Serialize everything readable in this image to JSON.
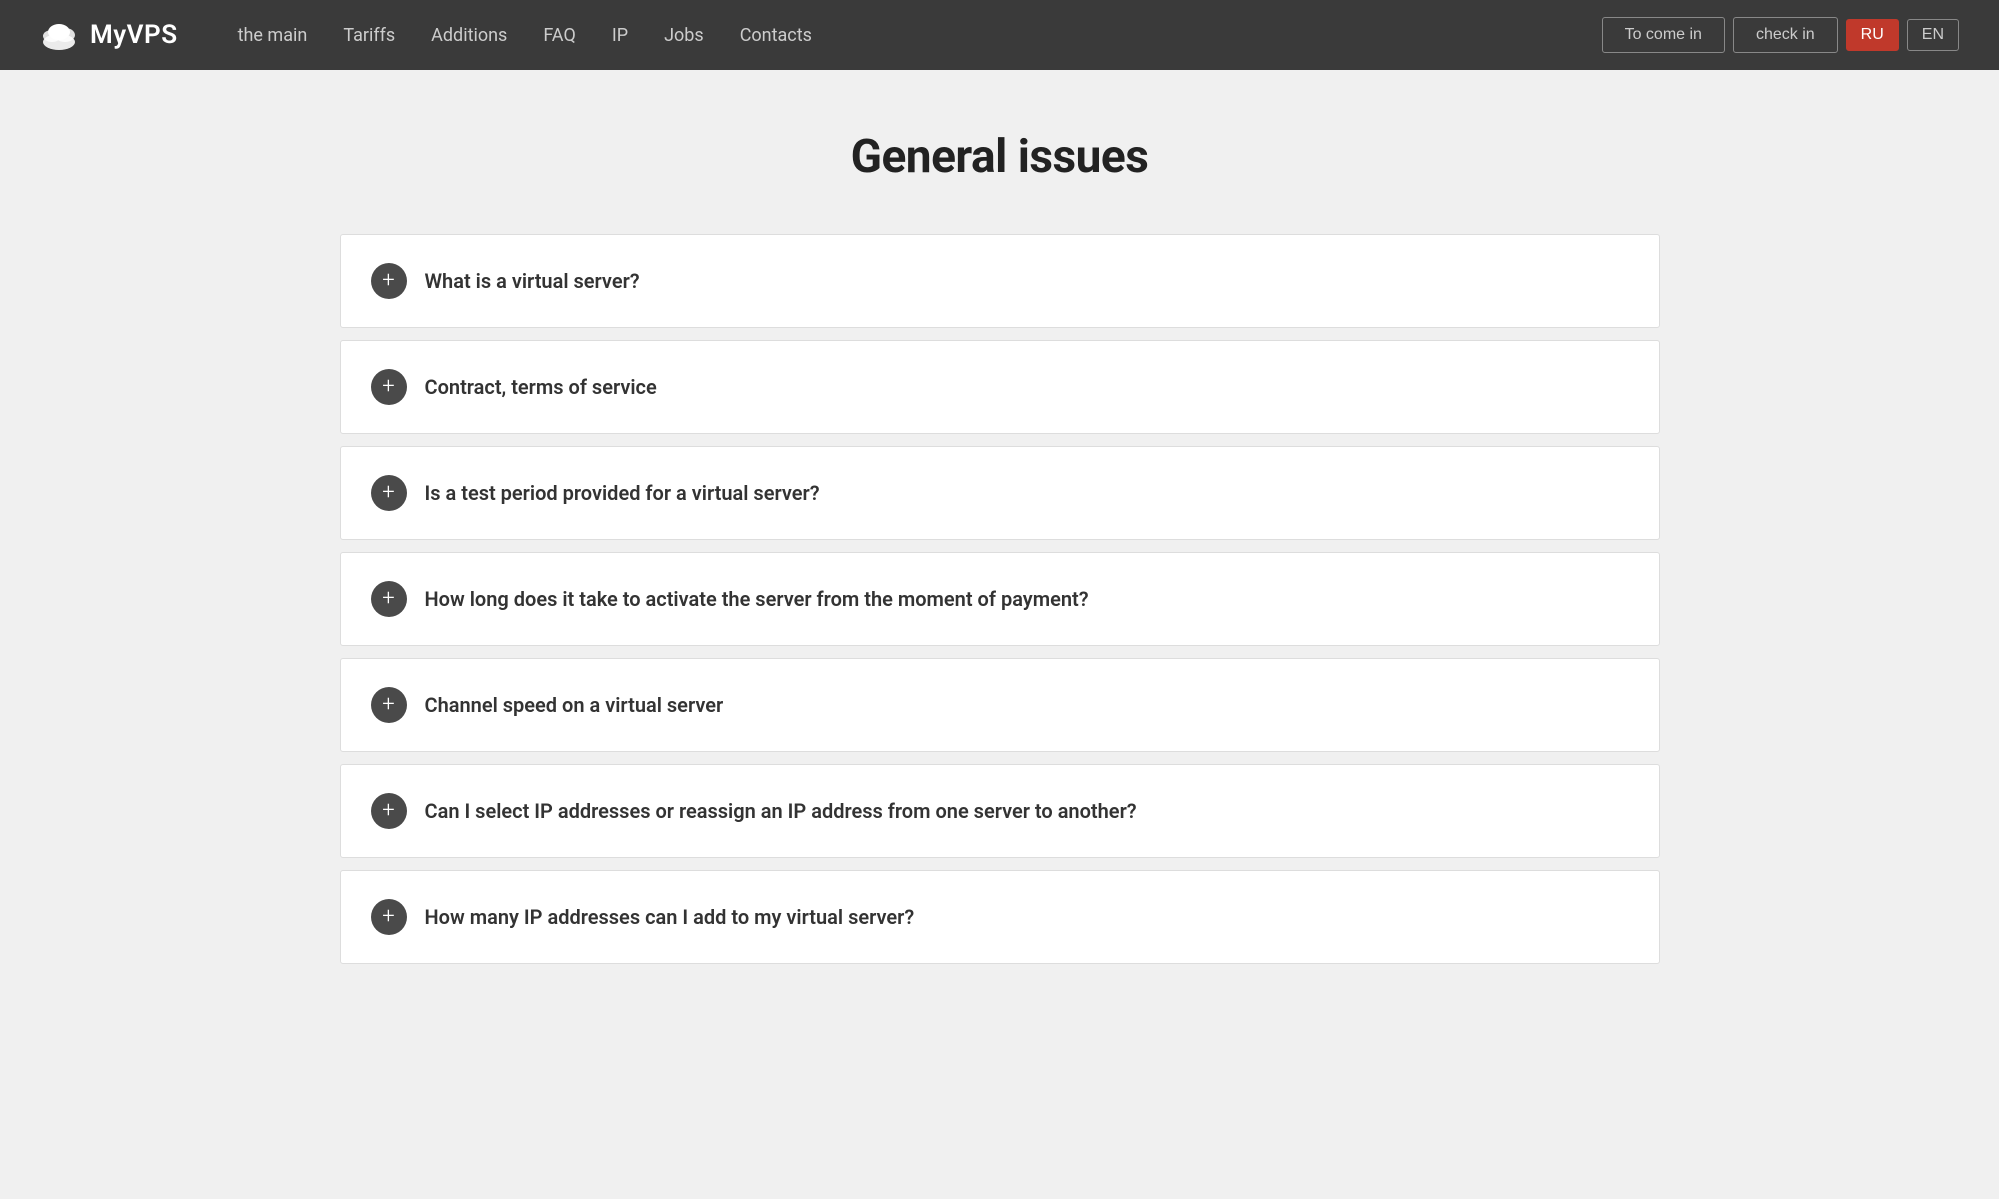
{
  "brand": {
    "name": "MyVPS"
  },
  "nav": {
    "items": [
      {
        "label": "the main",
        "id": "the-main"
      },
      {
        "label": "Tariffs",
        "id": "tariffs"
      },
      {
        "label": "Additions",
        "id": "additions"
      },
      {
        "label": "FAQ",
        "id": "faq"
      },
      {
        "label": "IP",
        "id": "ip"
      },
      {
        "label": "Jobs",
        "id": "jobs"
      },
      {
        "label": "Contacts",
        "id": "contacts"
      }
    ],
    "actions": [
      {
        "label": "To come in",
        "id": "login"
      },
      {
        "label": "check in",
        "id": "register"
      }
    ]
  },
  "lang": {
    "ru": "RU",
    "en": "EN",
    "active": "RU"
  },
  "page": {
    "title": "General issues"
  },
  "faq": {
    "items": [
      {
        "id": "q1",
        "question": "What is a virtual server?"
      },
      {
        "id": "q2",
        "question": "Contract, terms of service"
      },
      {
        "id": "q3",
        "question": "Is a test period provided for a virtual server?"
      },
      {
        "id": "q4",
        "question": "How long does it take to activate the server from the moment of payment?"
      },
      {
        "id": "q5",
        "question": "Channel speed on a virtual server"
      },
      {
        "id": "q6",
        "question": "Can I select IP addresses or reassign an IP address from one server to another?"
      },
      {
        "id": "q7",
        "question": "How many IP addresses can I add to my virtual server?"
      }
    ],
    "expand_icon": "+"
  }
}
